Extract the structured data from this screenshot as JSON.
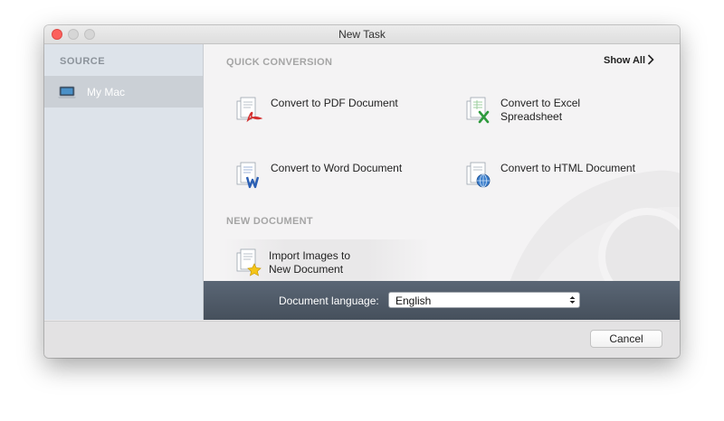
{
  "window": {
    "title": "New Task"
  },
  "sidebar": {
    "header": "SOURCE",
    "items": [
      {
        "label": "My Mac",
        "icon": "laptop-icon",
        "selected": true
      }
    ]
  },
  "quick_conversion": {
    "title": "QUICK CONVERSION",
    "show_all": "Show All",
    "actions": [
      {
        "label": "Convert to PDF Document",
        "icon": "pdf-document-icon"
      },
      {
        "label": "Convert to Excel\nSpreadsheet",
        "icon": "excel-document-icon"
      },
      {
        "label": "Convert to Word Document",
        "icon": "word-document-icon"
      },
      {
        "label": "Convert to HTML Document",
        "icon": "html-document-icon"
      }
    ]
  },
  "new_document": {
    "title": "NEW DOCUMENT",
    "import_label": "Import Images to\nNew Document",
    "icon": "import-images-icon"
  },
  "language_bar": {
    "label": "Document language:",
    "selected": "English"
  },
  "footer": {
    "cancel_label": "Cancel"
  },
  "colors": {
    "sidebar_bg": "#dde3ea",
    "language_bar_bg": "#4f5a67",
    "pdf_accent": "#d32f2f",
    "excel_accent": "#2e9a3d",
    "word_accent": "#2b5fb4",
    "html_accent": "#3b7ecc"
  }
}
